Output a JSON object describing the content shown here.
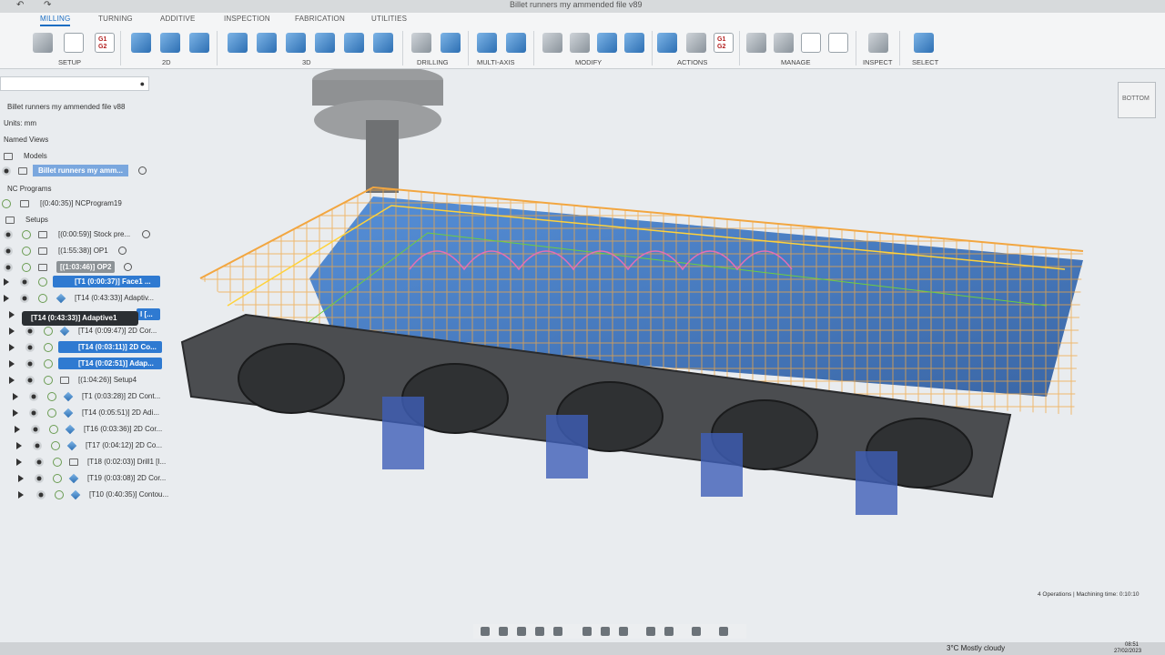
{
  "window": {
    "title": "Billet runners my ammended file v89"
  },
  "ribbon": {
    "tabs": [
      "MILLING",
      "TURNING",
      "ADDITIVE",
      "INSPECTION",
      "FABRICATION",
      "UTILITIES"
    ],
    "groups": [
      "SETUP",
      "2D",
      "3D",
      "DRILLING",
      "MULTI-AXIS",
      "MODIFY",
      "ACTIONS",
      "MANAGE",
      "INSPECT",
      "SELECT"
    ],
    "g1g2_label": "G1 G2"
  },
  "browser": {
    "file_name": "Billet runners my ammended file v88",
    "units": "Units: mm",
    "named_views": "Named Views",
    "models": "Models",
    "model_item": "Billet runners my amm...",
    "nc_programs": "NC Programs",
    "nc_program_item": "[(0:40:35)] NCProgram19",
    "setups": "Setups",
    "items": [
      "[(0:00:59)] Stock pre...",
      "[(1:55:38)] OP1",
      "[(1:03:46)] OP2",
      "[T1 (0:00:37)] Face1 ...",
      "[T14 (0:43:33)] Adaptiv...",
      "I [...",
      "[T14 (0:09:47)] 2D Cor...",
      "[T14 (0:03:11)] 2D Co...",
      "[T14 (0:02:51)] Adap...",
      "[(1:04:26)] Setup4",
      "[T1 (0:03:28)] 2D Cont...",
      "[T14 (0:05:51)] 2D Adi...",
      "[T16 (0:03:36)] 2D Cor...",
      "[T17 (0:04:12)] 2D Co...",
      "[T18 (0:02:03)] Drill1 [I...",
      "[T19 (0:03:08)] 2D Cor...",
      "[T10 (0:40:35)] Contou..."
    ],
    "tooltip": "[T14 (0:43:33)] Adaptive1"
  },
  "viewcube": {
    "label": "BOTTOM"
  },
  "status_bar": {
    "text": "4 Operations | Machining time: 0:10:10"
  },
  "taskbar": {
    "weather": "3°C  Mostly cloudy",
    "time": "08:51",
    "date": "27/02/2023"
  }
}
